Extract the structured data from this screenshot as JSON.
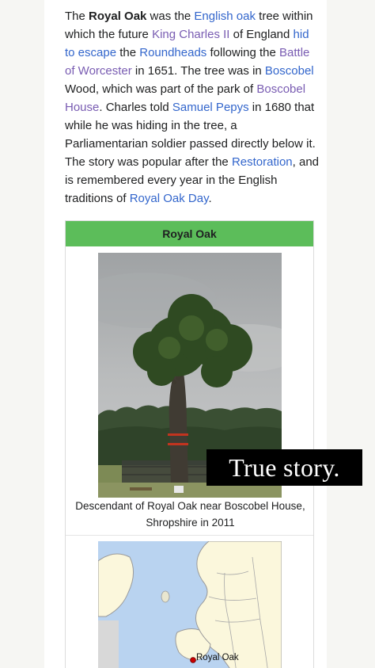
{
  "article": {
    "t1": "The ",
    "subject": "Royal Oak",
    "t2": " was the ",
    "link_english_oak": "English oak",
    "t3": " tree within which the future ",
    "link_charles": "King Charles II",
    "t4": " of England ",
    "link_escape": "hid to escape",
    "t5": " the ",
    "link_roundheads": "Roundheads",
    "t6": " following the ",
    "link_worcester": "Battle of Worcester",
    "t7": " in 1651. The tree was in ",
    "link_boscobel_wood": "Boscobel",
    "t8": " Wood, which was part of the park of ",
    "link_boscobel_house": "Boscobel House",
    "t9": ". Charles told ",
    "link_pepys": "Samuel Pepys",
    "t10": " in 1680 that while he was hiding in the tree, a Parliamentarian soldier passed directly below it. The story was popular after the ",
    "link_restoration": "Restoration",
    "t11": ", and is remembered every year in the English traditions of ",
    "link_royal_oak_day": "Royal Oak Day",
    "t12": "."
  },
  "infobox": {
    "title": "Royal Oak",
    "caption": "Descendant of Royal Oak near Boscobel House, Shropshire in 2011",
    "map_label": "Royal Oak"
  },
  "overlay": {
    "text": "True story."
  },
  "colors": {
    "link": "#3366cc",
    "visited_link": "#795cb2",
    "infobox_header": "#5cbd5a",
    "map_marker": "#cc0000"
  }
}
